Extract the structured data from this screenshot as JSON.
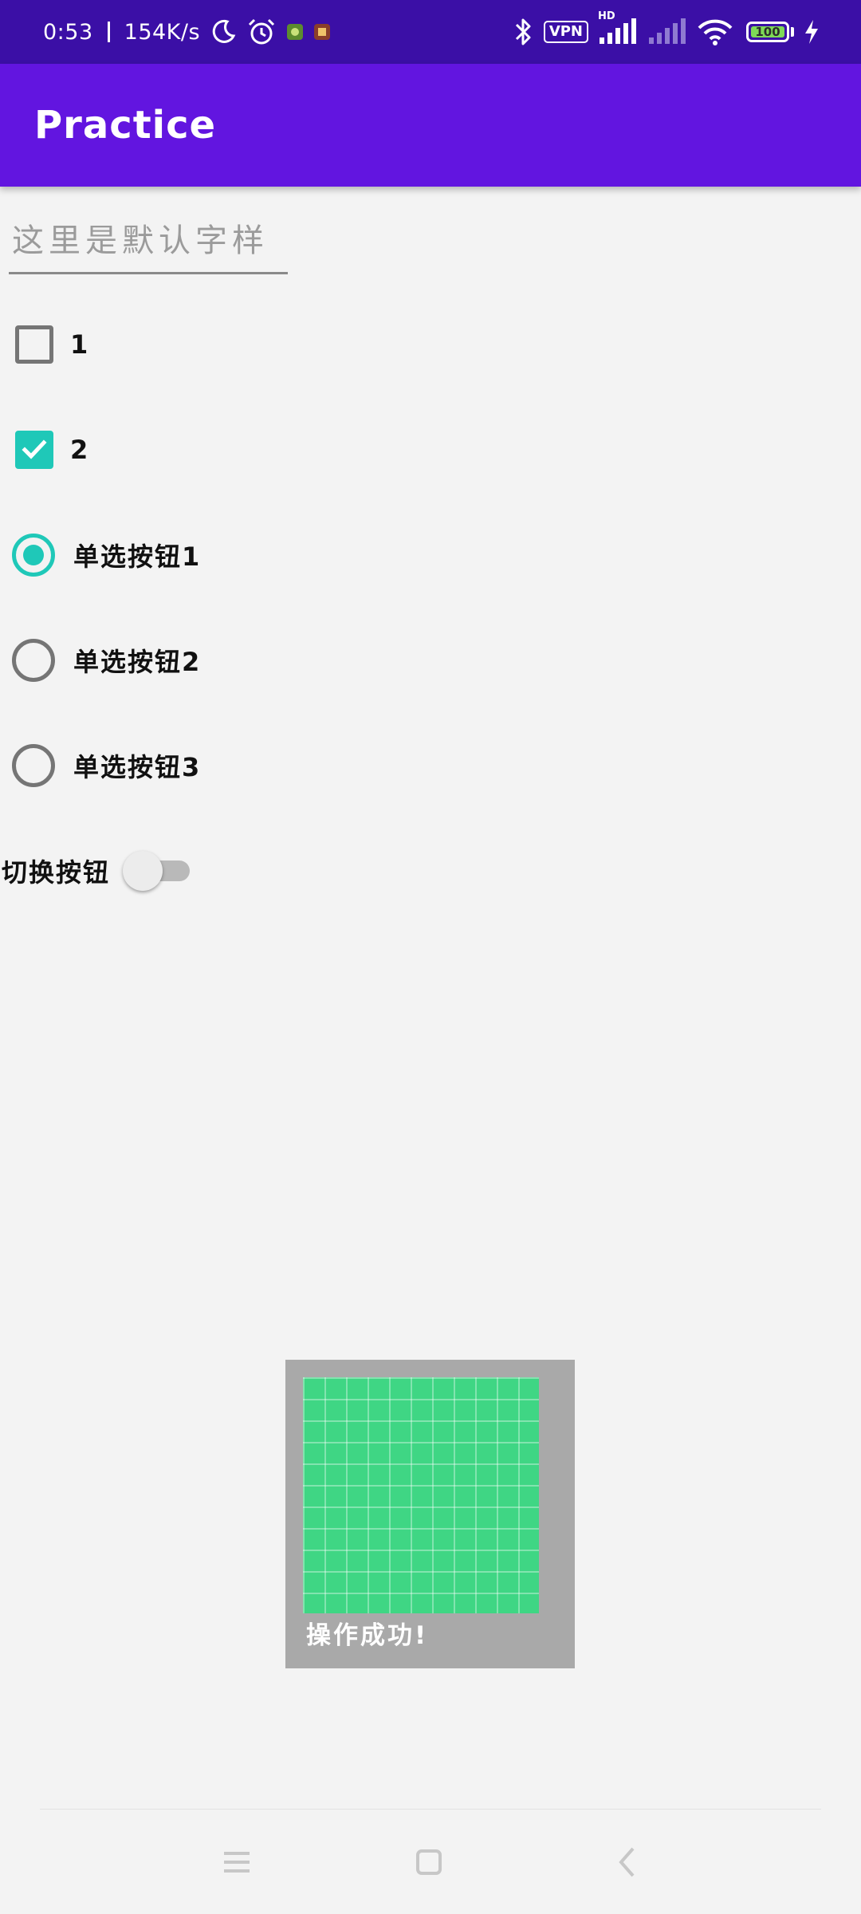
{
  "status_bar": {
    "time": "0:53",
    "net_speed": "154K/s",
    "vpn_label": "VPN",
    "hd_label": "HD",
    "battery_level": "100",
    "icons": [
      "moon-icon",
      "alarm-icon",
      "app-notification-icon",
      "app-notification-icon",
      "bluetooth-icon",
      "signal-icon",
      "wifi-icon",
      "battery-icon",
      "charging-icon"
    ]
  },
  "app_bar": {
    "title": "Practice",
    "color": "#6215e0"
  },
  "text_field": {
    "value": "",
    "placeholder": "这里是默认字样"
  },
  "checkboxes": [
    {
      "label": "1",
      "checked": false
    },
    {
      "label": "2",
      "checked": true
    }
  ],
  "radios": [
    {
      "label": "单选按钮1",
      "checked": true
    },
    {
      "label": "单选按钮2",
      "checked": false
    },
    {
      "label": "单选按钮3",
      "checked": false
    }
  ],
  "switch": {
    "label": "切换按钮",
    "on": false
  },
  "toast": {
    "message": "操作成功!"
  },
  "nav_bar": {
    "buttons": [
      "menu-icon",
      "home-icon",
      "back-icon"
    ]
  },
  "colors": {
    "accent": "#1fc8b8",
    "status_bar": "#3b0fa6",
    "background": "#f3f3f3"
  }
}
